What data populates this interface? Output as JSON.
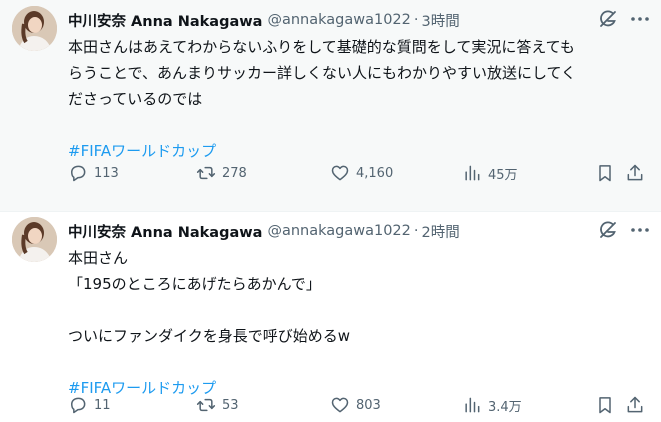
{
  "tweets": [
    {
      "author_name": "中川安奈 Anna Nakagawa",
      "handle": "@annakagawa1022",
      "separator": "·",
      "time": "3時間",
      "lines": [
        "本田さんはあえてわからないふりをして基礎的な質問をして実況に答えても",
        "らうことで、あんまりサッカー詳しくない人にもわかりやすい放送にしてく",
        "ださっているのでは"
      ],
      "hashtag": "#FIFAワールドカップ",
      "replies": "113",
      "retweets": "278",
      "likes": "4,160",
      "views": "45万"
    },
    {
      "author_name": "中川安奈 Anna Nakagawa",
      "handle": "@annakagawa1022",
      "separator": "·",
      "time": "2時間",
      "lines": [
        "本田さん",
        "「195のところにあげたらあかんで」",
        "",
        "ついにファンダイクを身長で呼び始めるw"
      ],
      "hashtag": "#FIFAワールドカップ",
      "replies": "11",
      "retweets": "53",
      "likes": "803",
      "views": "3.4万"
    }
  ],
  "icons": {
    "avatar": "avatar-photo",
    "grok": "grok-icon",
    "more": "more-icon",
    "reply": "reply-icon",
    "retweet": "retweet-icon",
    "like": "heart-icon",
    "views": "views-icon",
    "bookmark": "bookmark-icon",
    "share": "share-icon"
  },
  "colors": {
    "text": "#0f1419",
    "secondary": "#536471",
    "hashtag": "#1d9bf0",
    "highlight_bg": "#f7f9f9"
  }
}
